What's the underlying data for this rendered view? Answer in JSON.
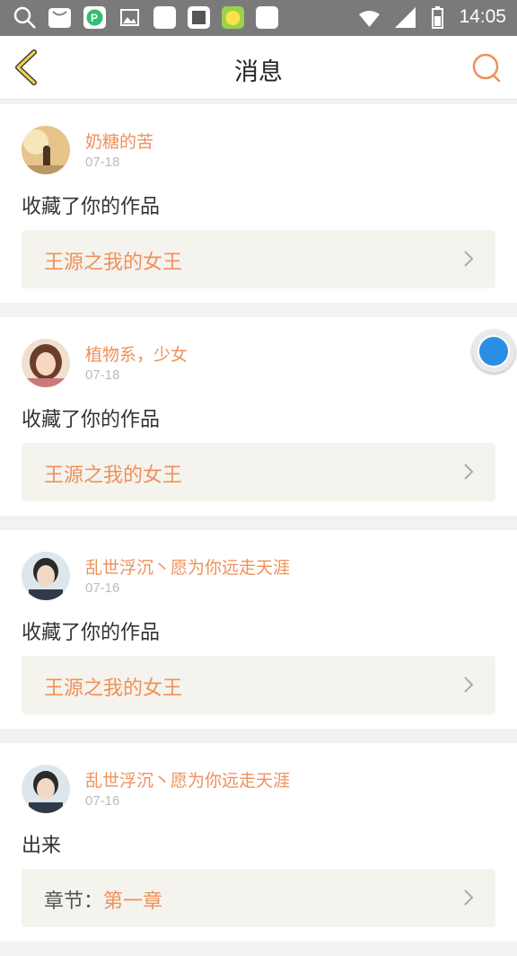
{
  "status_bar": {
    "time": "14:05"
  },
  "header": {
    "title": "消息"
  },
  "colors": {
    "accent": "#f0905a",
    "float_button": "#2b8ee5"
  },
  "messages": [
    {
      "username": "奶糖的苦",
      "date": "07-18",
      "action": "收藏了你的作品",
      "ref_prefix": "",
      "ref_title": "王源之我的女王"
    },
    {
      "username": "植物系，少女",
      "date": "07-18",
      "action": "收藏了你的作品",
      "ref_prefix": "",
      "ref_title": "王源之我的女王"
    },
    {
      "username": "乱世浮沉丶愿为你远走天涯",
      "date": "07-16",
      "action": "收藏了你的作品",
      "ref_prefix": "",
      "ref_title": "王源之我的女王"
    },
    {
      "username": "乱世浮沉丶愿为你远走天涯",
      "date": "07-16",
      "action": "出来",
      "ref_prefix": "章节：",
      "ref_title": "第一章"
    }
  ]
}
